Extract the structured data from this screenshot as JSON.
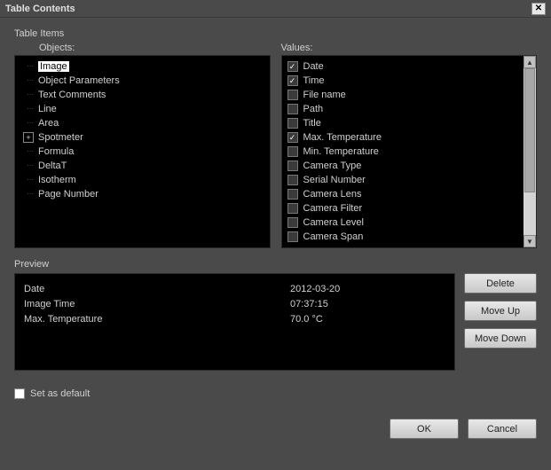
{
  "window": {
    "title": "Table Contents"
  },
  "tableItems": {
    "label": "Table Items"
  },
  "objects": {
    "label": "Objects:",
    "items": [
      {
        "label": "Image",
        "selected": true
      },
      {
        "label": "Object Parameters"
      },
      {
        "label": "Text Comments"
      },
      {
        "label": "Line"
      },
      {
        "label": "Area"
      },
      {
        "label": "Spotmeter",
        "expandable": true
      },
      {
        "label": "Formula"
      },
      {
        "label": "DeltaT"
      },
      {
        "label": "Isotherm"
      },
      {
        "label": "Page Number"
      }
    ]
  },
  "values": {
    "label": "Values:",
    "items": [
      {
        "label": "Date",
        "checked": true
      },
      {
        "label": "Time",
        "checked": true
      },
      {
        "label": "File name",
        "checked": false
      },
      {
        "label": "Path",
        "checked": false
      },
      {
        "label": "Title",
        "checked": false
      },
      {
        "label": "Max. Temperature",
        "checked": true
      },
      {
        "label": "Min. Temperature",
        "checked": false
      },
      {
        "label": "Camera Type",
        "checked": false
      },
      {
        "label": "Serial Number",
        "checked": false
      },
      {
        "label": "Camera Lens",
        "checked": false
      },
      {
        "label": "Camera Filter",
        "checked": false
      },
      {
        "label": "Camera Level",
        "checked": false
      },
      {
        "label": "Camera Span",
        "checked": false
      }
    ]
  },
  "preview": {
    "label": "Preview",
    "rows": [
      {
        "key": "Date",
        "value": "2012-03-20"
      },
      {
        "key": "Image Time",
        "value": "07:37:15"
      },
      {
        "key": "Max. Temperature",
        "value": "70.0 °C"
      }
    ]
  },
  "buttons": {
    "delete": "Delete",
    "moveUp": "Move Up",
    "moveDown": "Move Down",
    "ok": "OK",
    "cancel": "Cancel"
  },
  "setAsDefault": {
    "label": "Set as default",
    "checked": false
  }
}
